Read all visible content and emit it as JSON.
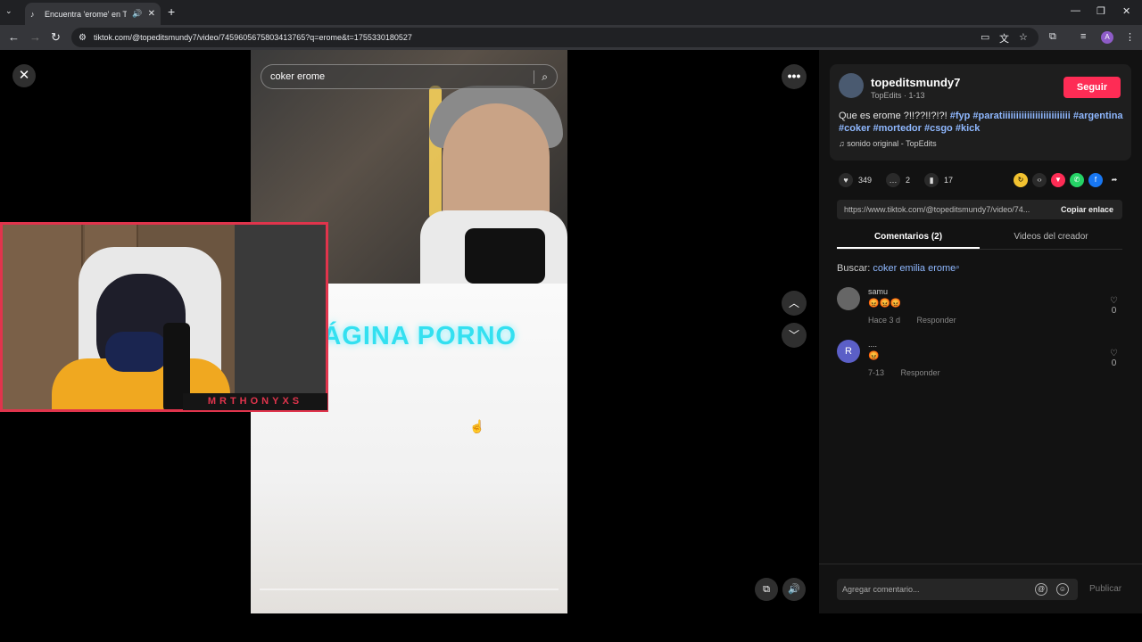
{
  "browser": {
    "tab_title": "Encuentra 'erome' en TikTo",
    "url": "tiktok.com/@topeditsmundy7/video/7459605675803413765?q=erome&t=1755330180527"
  },
  "viewer": {
    "search_query": "coker erome",
    "video_caption": "PÁGINA PORNO",
    "streamer_name": "MRTHONYXS"
  },
  "panel": {
    "username": "topeditsmundy7",
    "subtitle": "TopEdits · 1-13",
    "follow_label": "Seguir",
    "desc_text": "Que es erome ?!!??!!?!?! ",
    "desc_tags": "#fyp #paratiiiiiiiiiiiiiiiiiiiiiiiii #argentina #coker #mortedor #csgo #kick",
    "music": "sonido original - TopEdits",
    "likes": "349",
    "comments": "2",
    "saves": "17",
    "link": "https://www.tiktok.com/@topeditsmundy7/video/74...",
    "copy_label": "Copiar enlace",
    "tab_comments": "Comentarios (2)",
    "tab_videos": "Videos del creador",
    "search_prefix": "Buscar: ",
    "search_suggestion": "coker emilia erome",
    "comment_list": [
      {
        "name": "samu",
        "text": "😡😡😡",
        "time": "Hace 3 d",
        "reply": "Responder",
        "likes": "0",
        "initial": ""
      },
      {
        "name": "....",
        "text": "😡",
        "time": "7-13",
        "reply": "Responder",
        "likes": "0",
        "initial": "R"
      }
    ],
    "comment_placeholder": "Agregar comentario...",
    "publish_label": "Publicar"
  }
}
